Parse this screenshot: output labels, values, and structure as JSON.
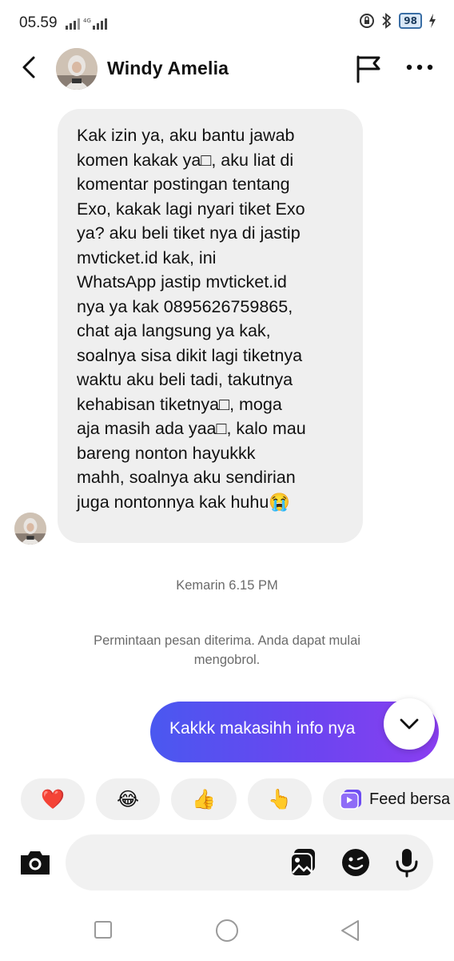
{
  "status_bar": {
    "time": "05.59",
    "network": "4G",
    "battery": "98"
  },
  "header": {
    "contact_name": "Windy Amelia",
    "icons": [
      "back-arrow-icon",
      "avatar",
      "flag-icon",
      "more-icon"
    ]
  },
  "messages": {
    "incoming_text": "Kak izin ya, aku bantu jawab\nkomen kakak ya□, aku liat di\nkomentar postingan tentang\nExo, kakak lagi nyari tiket Exo\nya? aku beli tiket nya di jastip\nmvticket.id kak, ini\nWhatsApp jastip mvticket.id\nnya ya kak 0895626759865,\nchat aja langsung ya kak,\nsoalnya sisa dikit lagi tiketnya\nwaktu aku beli tadi, takutnya\nkehabisan tiketnya□, moga\naja masih ada yaa□, kalo mau\nbareng nonton hayukkk\nmahh, soalnya aku sendirian\njuga nontonnya kak huhu😭",
    "timestamp": "Kemarin 6.15 PM",
    "system_notice": "Permintaan pesan diterima. Anda dapat mulai mengobrol.",
    "outgoing_text": "Kakkk makasihh info nya"
  },
  "quick_reactions": {
    "heart": "❤️",
    "laugh": "😂",
    "thumbs_up": "👍",
    "point": "👆",
    "feed_label": "Feed bersa"
  },
  "composer": {
    "icons": [
      "camera-icon",
      "gallery-icon",
      "sticker-icon",
      "mic-icon"
    ]
  },
  "colors": {
    "accent_start": "#4a58f0",
    "accent_end": "#8a3ef0",
    "bubble_in": "#efefef"
  }
}
